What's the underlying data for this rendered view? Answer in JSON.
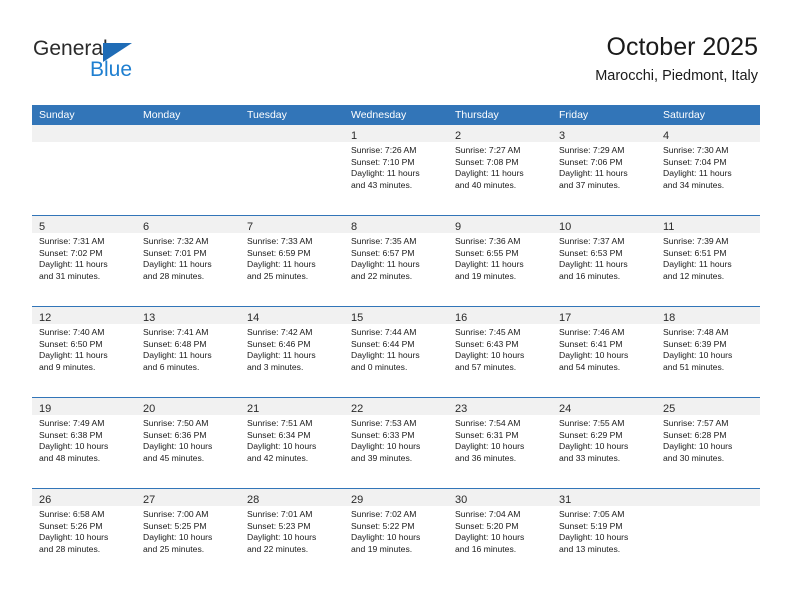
{
  "brand": {
    "word1": "General",
    "word2": "Blue",
    "triangle_color": "#1f6cb6",
    "blue_text_color": "#1f7fd0"
  },
  "header": {
    "title": "October 2025",
    "subtitle": "Marocchi, Piedmont, Italy",
    "header_bg": "#3275b8",
    "header_text_color": "#ffffff"
  },
  "weekdays": [
    "Sunday",
    "Monday",
    "Tuesday",
    "Wednesday",
    "Thursday",
    "Friday",
    "Saturday"
  ],
  "labels": {
    "sunrise_prefix": "Sunrise:",
    "sunset_prefix": "Sunset:",
    "daylight_prefix": "Daylight:"
  },
  "weeks": [
    [
      {
        "day": "",
        "empty": true,
        "sunrise": "",
        "sunset": "",
        "daylight_line1": "",
        "daylight_line2": ""
      },
      {
        "day": "",
        "empty": true,
        "sunrise": "",
        "sunset": "",
        "daylight_line1": "",
        "daylight_line2": ""
      },
      {
        "day": "",
        "empty": true,
        "sunrise": "",
        "sunset": "",
        "daylight_line1": "",
        "daylight_line2": ""
      },
      {
        "day": "1",
        "empty": false,
        "sunrise": "Sunrise: 7:26 AM",
        "sunset": "Sunset: 7:10 PM",
        "daylight_line1": "Daylight: 11 hours",
        "daylight_line2": "and 43 minutes."
      },
      {
        "day": "2",
        "empty": false,
        "sunrise": "Sunrise: 7:27 AM",
        "sunset": "Sunset: 7:08 PM",
        "daylight_line1": "Daylight: 11 hours",
        "daylight_line2": "and 40 minutes."
      },
      {
        "day": "3",
        "empty": false,
        "sunrise": "Sunrise: 7:29 AM",
        "sunset": "Sunset: 7:06 PM",
        "daylight_line1": "Daylight: 11 hours",
        "daylight_line2": "and 37 minutes."
      },
      {
        "day": "4",
        "empty": false,
        "sunrise": "Sunrise: 7:30 AM",
        "sunset": "Sunset: 7:04 PM",
        "daylight_line1": "Daylight: 11 hours",
        "daylight_line2": "and 34 minutes."
      }
    ],
    [
      {
        "day": "5",
        "empty": false,
        "sunrise": "Sunrise: 7:31 AM",
        "sunset": "Sunset: 7:02 PM",
        "daylight_line1": "Daylight: 11 hours",
        "daylight_line2": "and 31 minutes."
      },
      {
        "day": "6",
        "empty": false,
        "sunrise": "Sunrise: 7:32 AM",
        "sunset": "Sunset: 7:01 PM",
        "daylight_line1": "Daylight: 11 hours",
        "daylight_line2": "and 28 minutes."
      },
      {
        "day": "7",
        "empty": false,
        "sunrise": "Sunrise: 7:33 AM",
        "sunset": "Sunset: 6:59 PM",
        "daylight_line1": "Daylight: 11 hours",
        "daylight_line2": "and 25 minutes."
      },
      {
        "day": "8",
        "empty": false,
        "sunrise": "Sunrise: 7:35 AM",
        "sunset": "Sunset: 6:57 PM",
        "daylight_line1": "Daylight: 11 hours",
        "daylight_line2": "and 22 minutes."
      },
      {
        "day": "9",
        "empty": false,
        "sunrise": "Sunrise: 7:36 AM",
        "sunset": "Sunset: 6:55 PM",
        "daylight_line1": "Daylight: 11 hours",
        "daylight_line2": "and 19 minutes."
      },
      {
        "day": "10",
        "empty": false,
        "sunrise": "Sunrise: 7:37 AM",
        "sunset": "Sunset: 6:53 PM",
        "daylight_line1": "Daylight: 11 hours",
        "daylight_line2": "and 16 minutes."
      },
      {
        "day": "11",
        "empty": false,
        "sunrise": "Sunrise: 7:39 AM",
        "sunset": "Sunset: 6:51 PM",
        "daylight_line1": "Daylight: 11 hours",
        "daylight_line2": "and 12 minutes."
      }
    ],
    [
      {
        "day": "12",
        "empty": false,
        "sunrise": "Sunrise: 7:40 AM",
        "sunset": "Sunset: 6:50 PM",
        "daylight_line1": "Daylight: 11 hours",
        "daylight_line2": "and 9 minutes."
      },
      {
        "day": "13",
        "empty": false,
        "sunrise": "Sunrise: 7:41 AM",
        "sunset": "Sunset: 6:48 PM",
        "daylight_line1": "Daylight: 11 hours",
        "daylight_line2": "and 6 minutes."
      },
      {
        "day": "14",
        "empty": false,
        "sunrise": "Sunrise: 7:42 AM",
        "sunset": "Sunset: 6:46 PM",
        "daylight_line1": "Daylight: 11 hours",
        "daylight_line2": "and 3 minutes."
      },
      {
        "day": "15",
        "empty": false,
        "sunrise": "Sunrise: 7:44 AM",
        "sunset": "Sunset: 6:44 PM",
        "daylight_line1": "Daylight: 11 hours",
        "daylight_line2": "and 0 minutes."
      },
      {
        "day": "16",
        "empty": false,
        "sunrise": "Sunrise: 7:45 AM",
        "sunset": "Sunset: 6:43 PM",
        "daylight_line1": "Daylight: 10 hours",
        "daylight_line2": "and 57 minutes."
      },
      {
        "day": "17",
        "empty": false,
        "sunrise": "Sunrise: 7:46 AM",
        "sunset": "Sunset: 6:41 PM",
        "daylight_line1": "Daylight: 10 hours",
        "daylight_line2": "and 54 minutes."
      },
      {
        "day": "18",
        "empty": false,
        "sunrise": "Sunrise: 7:48 AM",
        "sunset": "Sunset: 6:39 PM",
        "daylight_line1": "Daylight: 10 hours",
        "daylight_line2": "and 51 minutes."
      }
    ],
    [
      {
        "day": "19",
        "empty": false,
        "sunrise": "Sunrise: 7:49 AM",
        "sunset": "Sunset: 6:38 PM",
        "daylight_line1": "Daylight: 10 hours",
        "daylight_line2": "and 48 minutes."
      },
      {
        "day": "20",
        "empty": false,
        "sunrise": "Sunrise: 7:50 AM",
        "sunset": "Sunset: 6:36 PM",
        "daylight_line1": "Daylight: 10 hours",
        "daylight_line2": "and 45 minutes."
      },
      {
        "day": "21",
        "empty": false,
        "sunrise": "Sunrise: 7:51 AM",
        "sunset": "Sunset: 6:34 PM",
        "daylight_line1": "Daylight: 10 hours",
        "daylight_line2": "and 42 minutes."
      },
      {
        "day": "22",
        "empty": false,
        "sunrise": "Sunrise: 7:53 AM",
        "sunset": "Sunset: 6:33 PM",
        "daylight_line1": "Daylight: 10 hours",
        "daylight_line2": "and 39 minutes."
      },
      {
        "day": "23",
        "empty": false,
        "sunrise": "Sunrise: 7:54 AM",
        "sunset": "Sunset: 6:31 PM",
        "daylight_line1": "Daylight: 10 hours",
        "daylight_line2": "and 36 minutes."
      },
      {
        "day": "24",
        "empty": false,
        "sunrise": "Sunrise: 7:55 AM",
        "sunset": "Sunset: 6:29 PM",
        "daylight_line1": "Daylight: 10 hours",
        "daylight_line2": "and 33 minutes."
      },
      {
        "day": "25",
        "empty": false,
        "sunrise": "Sunrise: 7:57 AM",
        "sunset": "Sunset: 6:28 PM",
        "daylight_line1": "Daylight: 10 hours",
        "daylight_line2": "and 30 minutes."
      }
    ],
    [
      {
        "day": "26",
        "empty": false,
        "sunrise": "Sunrise: 6:58 AM",
        "sunset": "Sunset: 5:26 PM",
        "daylight_line1": "Daylight: 10 hours",
        "daylight_line2": "and 28 minutes."
      },
      {
        "day": "27",
        "empty": false,
        "sunrise": "Sunrise: 7:00 AM",
        "sunset": "Sunset: 5:25 PM",
        "daylight_line1": "Daylight: 10 hours",
        "daylight_line2": "and 25 minutes."
      },
      {
        "day": "28",
        "empty": false,
        "sunrise": "Sunrise: 7:01 AM",
        "sunset": "Sunset: 5:23 PM",
        "daylight_line1": "Daylight: 10 hours",
        "daylight_line2": "and 22 minutes."
      },
      {
        "day": "29",
        "empty": false,
        "sunrise": "Sunrise: 7:02 AM",
        "sunset": "Sunset: 5:22 PM",
        "daylight_line1": "Daylight: 10 hours",
        "daylight_line2": "and 19 minutes."
      },
      {
        "day": "30",
        "empty": false,
        "sunrise": "Sunrise: 7:04 AM",
        "sunset": "Sunset: 5:20 PM",
        "daylight_line1": "Daylight: 10 hours",
        "daylight_line2": "and 16 minutes."
      },
      {
        "day": "31",
        "empty": false,
        "sunrise": "Sunrise: 7:05 AM",
        "sunset": "Sunset: 5:19 PM",
        "daylight_line1": "Daylight: 10 hours",
        "daylight_line2": "and 13 minutes."
      },
      {
        "day": "",
        "empty": true,
        "sunrise": "",
        "sunset": "",
        "daylight_line1": "",
        "daylight_line2": ""
      }
    ]
  ]
}
